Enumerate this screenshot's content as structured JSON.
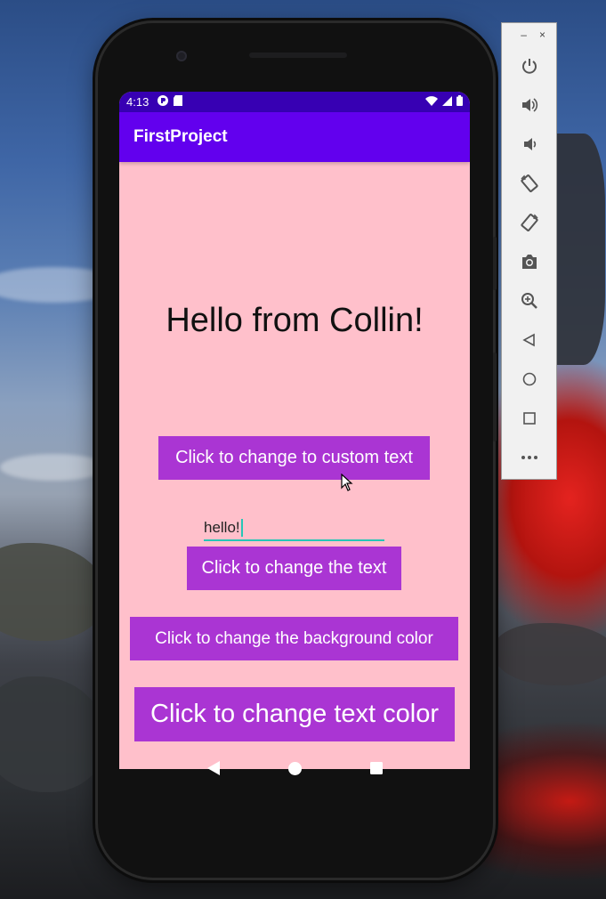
{
  "status_bar": {
    "time": "4:13"
  },
  "app_bar": {
    "title": "FirstProject"
  },
  "main": {
    "greeting": "Hello from Collin!",
    "custom_text_button": "Click to change to custom text",
    "text_input": {
      "value": "hello!"
    },
    "change_text_button": "Click to change the text",
    "background_color_button": "Click to change the background color",
    "text_color_button": "Click to change text color"
  },
  "emulator_toolbar": {
    "minimize": "–",
    "close": "×",
    "items": [
      "power-icon",
      "volume-up-icon",
      "volume-down-icon",
      "rotate-left-icon",
      "rotate-right-icon",
      "camera-icon",
      "zoom-icon",
      "back-icon",
      "home-icon",
      "overview-icon",
      "more-icon"
    ]
  },
  "colors": {
    "background": "#ffc0cb",
    "app_bar": "#6200ee",
    "status_bar": "#3700b3",
    "button": "#aa35d3",
    "input_underline": "#26c6b6"
  }
}
